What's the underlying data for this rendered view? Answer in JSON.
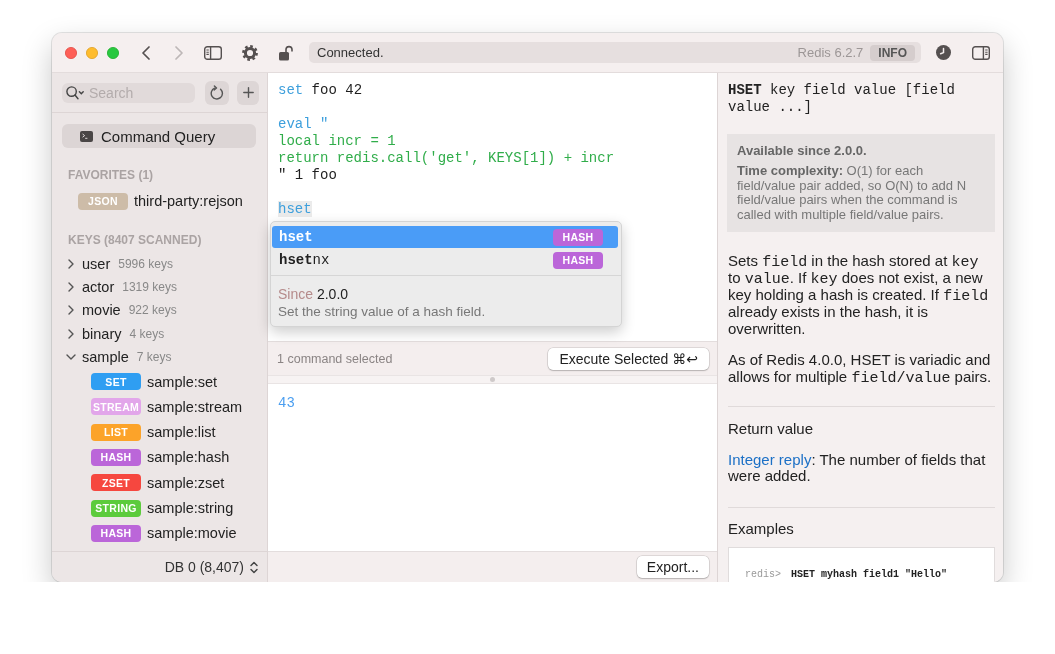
{
  "toolbar": {
    "back": {
      "disabled": false
    },
    "forward": {
      "disabled": true
    },
    "lock": {
      "locked": false
    },
    "status": "Connected.",
    "server": "Redis 6.2.7",
    "info_button": "INFO"
  },
  "sidebar": {
    "search": {
      "placeholder": "Search"
    },
    "nav": [
      {
        "label": "Command Query",
        "selected": true
      }
    ],
    "favorites": {
      "title": "FAVORITES (1)",
      "items": [
        {
          "type": "JSON",
          "name": "third-party:rejson",
          "color": "#cdbca8"
        }
      ]
    },
    "keys": {
      "title": "KEYS (8407 SCANNED)",
      "groups": [
        {
          "name": "user",
          "count": "5996 keys",
          "expanded": false
        },
        {
          "name": "actor",
          "count": "1319 keys",
          "expanded": false
        },
        {
          "name": "movie",
          "count": "922 keys",
          "expanded": false
        },
        {
          "name": "binary",
          "count": "4 keys",
          "expanded": false
        },
        {
          "name": "sample",
          "count": "7 keys",
          "expanded": true,
          "children": [
            {
              "type": "SET",
              "name": "sample:set",
              "color": "#2f9ef2"
            },
            {
              "type": "STREAM",
              "name": "sample:stream",
              "color": "#e2a6ea"
            },
            {
              "type": "LIST",
              "name": "sample:list",
              "color": "#fca329"
            },
            {
              "type": "HASH",
              "name": "sample:hash",
              "color": "#bb66d9"
            },
            {
              "type": "ZSET",
              "name": "sample:zset",
              "color": "#f6473f"
            },
            {
              "type": "STRING",
              "name": "sample:string",
              "color": "#5ccb3c"
            },
            {
              "type": "HASH",
              "name": "sample:movie",
              "color": "#bb66d9"
            }
          ]
        }
      ]
    },
    "database": "DB 0 (8,407)"
  },
  "editor": {
    "blocks": [
      {
        "lines": [
          [
            {
              "text": "set",
              "kind": "command",
              "highlighted": false
            },
            {
              "text": " foo 42",
              "kind": "plain",
              "highlighted": false
            }
          ]
        ]
      },
      {
        "lines": [
          [
            {
              "text": "eval \"",
              "kind": "command",
              "highlighted": false
            }
          ],
          [
            {
              "text": "local incr = 1",
              "kind": "script",
              "highlighted": false
            }
          ],
          [
            {
              "text": "return redis.call('get', KEYS[1]) + incr",
              "kind": "script",
              "highlighted": false
            }
          ],
          [
            {
              "text": "\" 1 foo",
              "kind": "plain",
              "highlighted": false
            }
          ]
        ]
      },
      {
        "lines": [
          [
            {
              "text": "hset",
              "kind": "command",
              "highlighted": true
            }
          ]
        ]
      }
    ],
    "autocomplete": {
      "items": [
        {
          "match": "hset",
          "type": "HASH",
          "color": "#bb66d9",
          "selected": true
        },
        {
          "match": "hset",
          "rest": "nx",
          "type": "HASH",
          "color": "#bb66d9",
          "selected": false
        }
      ],
      "since_label": "Since",
      "since": "2.0.0",
      "summary": "Set the string value of a hash field."
    },
    "selection_status": "1 command selected",
    "execute_button": "Execute Selected ⌘↩"
  },
  "results": {
    "lines": [
      "43"
    ],
    "export_button": "Export..."
  },
  "docs": {
    "syntax": "**HSET** key field value [field value ...]",
    "availability": "Available since 2.0.0.",
    "complexity": "**Time complexity:** O(1) for each field/value pair added, so O(N) to add N field/value pairs when the command is called with multiple field/value pairs.",
    "description": [
      [
        {
          "text": "Sets ",
          "kind": "plain"
        },
        {
          "text": "field",
          "kind": "code"
        },
        {
          "text": " in the hash stored at ",
          "kind": "plain"
        },
        {
          "text": "key",
          "kind": "code"
        },
        {
          "text": " to ",
          "kind": "plain"
        },
        {
          "text": "value",
          "kind": "code"
        },
        {
          "text": ". If ",
          "kind": "plain"
        },
        {
          "text": "key",
          "kind": "code"
        },
        {
          "text": " does not exist, a new key holding a hash is created. If ",
          "kind": "plain"
        },
        {
          "text": "field",
          "kind": "code"
        },
        {
          "text": " already exists in the hash, it is overwritten.",
          "kind": "plain"
        }
      ],
      [
        {
          "text": "As of Redis 4.0.0, HSET is variadic and allows for multiple ",
          "kind": "plain"
        },
        {
          "text": "field/value",
          "kind": "code"
        },
        {
          "text": " pairs.",
          "kind": "plain"
        }
      ]
    ],
    "return_heading": "Return value",
    "return_link": "Integer reply",
    "return_text": ": The number of fields that were added.",
    "examples_heading": "Examples",
    "example": {
      "prompt": "redis>",
      "command": "HSET myhash field1 \"Hello\""
    }
  }
}
